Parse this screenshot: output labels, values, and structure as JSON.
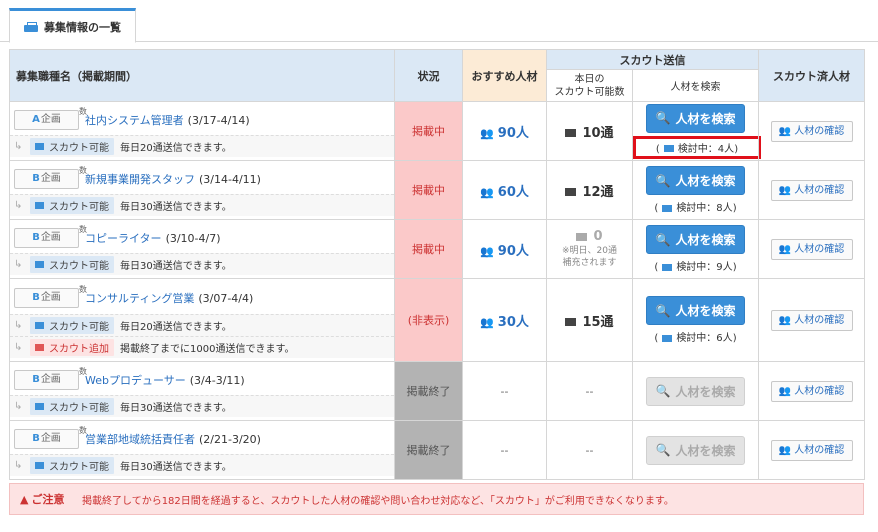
{
  "tab": {
    "label": "募集情報の一覧"
  },
  "headers": {
    "name": "募集職種名（掲載期間）",
    "status": "状況",
    "recommend": "おすすめ人材",
    "scout_send": "スカウト送信",
    "today_line1": "本日の",
    "today_line2": "スカウト可能数",
    "search": "人材を検索",
    "scouted": "スカウト済人材"
  },
  "labels": {
    "search_button": "人材を検索",
    "check_button": "人材の確認",
    "scout_ok": "スカウト可能",
    "scout_add": "スカウト追加",
    "plan_suffix": "企画",
    "su": "数",
    "dash": "--"
  },
  "rows": [
    {
      "plan": "A",
      "title": "社内システム管理者",
      "period": "(3/17-4/14)",
      "status": "掲載中",
      "recommend": "90人",
      "count": "10通",
      "review": "検討中：4人",
      "sub": "毎日20通送信できます。"
    },
    {
      "plan": "B",
      "title": "新規事業開発スタッフ",
      "period": "(3/14-4/11)",
      "status": "掲載中",
      "recommend": "60人",
      "count": "12通",
      "review": "検討中：8人",
      "sub": "毎日30通送信できます。"
    },
    {
      "plan": "B",
      "title": "コピーライター",
      "period": "(3/10-4/7)",
      "status": "掲載中",
      "recommend": "90人",
      "count": "0",
      "count_note1": "※明日、20通",
      "count_note2": "補充されます",
      "review": "検討中：9人",
      "sub": "毎日30通送信できます。"
    },
    {
      "plan": "B",
      "title": "コンサルティング営業",
      "period": "(3/07-4/4)",
      "status": "(非表示)",
      "recommend": "30人",
      "count": "15通",
      "review": "検討中：6人",
      "sub": "毎日20通送信できます。",
      "sub2": "掲載終了までに1000通送信できます。"
    },
    {
      "plan": "B",
      "title": "Webプロデューサー",
      "period": "(3/4-3/11)",
      "status": "掲載終了",
      "sub": "毎日30通送信できます。"
    },
    {
      "plan": "B",
      "title": "営業部地域統括責任者",
      "period": "(2/21-3/20)",
      "status": "掲載終了",
      "sub": "毎日30通送信できます。"
    }
  ],
  "caution": {
    "label": "ご注意",
    "text": "掲載終了してから182日間を経過すると、スカウトした人材の確認や問い合わせ対応など、「スカウト」がご利用できなくなります。"
  },
  "colors": {
    "accent": "#3a8fd8",
    "live": "#fbc9c9",
    "ended": "#b3b3b3",
    "highlight": "#e0101a"
  }
}
